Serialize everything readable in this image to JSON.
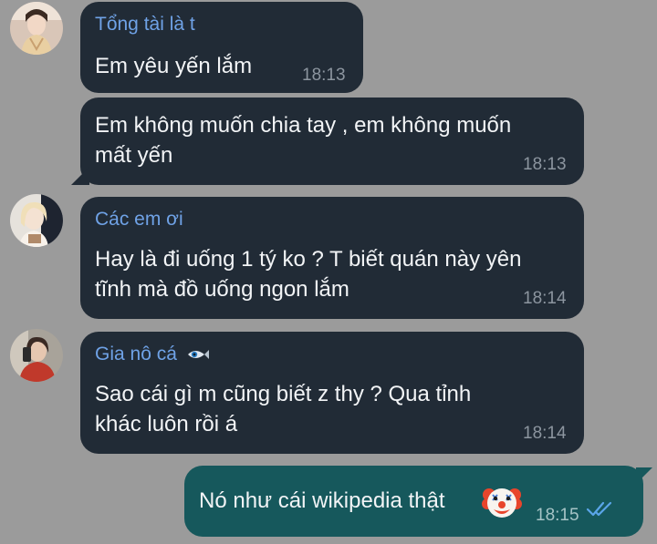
{
  "messages": [
    {
      "sender": "Tổng tài là t",
      "lines": [
        "Em yêu yến lắm"
      ],
      "time": "18:13"
    },
    {
      "lines": [
        "Em không muốn chia tay , em không muốn",
        "mất yến"
      ],
      "time": "18:13"
    },
    {
      "sender": "Các em ơi",
      "lines": [
        "Hay là đi uống 1 tý ko ? T biết quán này yên",
        "tĩnh mà đồ uống ngon lắm"
      ],
      "time": "18:14"
    },
    {
      "sender": "Gia nô cá",
      "sender_icon": "fish-eye-icon",
      "lines": [
        "Sao cái gì m cũng biết z thy ? Qua tỉnh",
        "khác luôn rồi á"
      ],
      "time": "18:14"
    },
    {
      "outgoing": true,
      "lines": [
        "Nó như cái wikipedia thật"
      ],
      "emoji": "clown-face-icon",
      "time": "18:15",
      "status_icon": "double-check-icon"
    }
  ],
  "colors": {
    "background": "#9b9b9b",
    "incoming_bubble": "#212b36",
    "outgoing_bubble": "#16585c",
    "sender_name": "#6fa2e6",
    "read_check": "#5aa5e8"
  }
}
